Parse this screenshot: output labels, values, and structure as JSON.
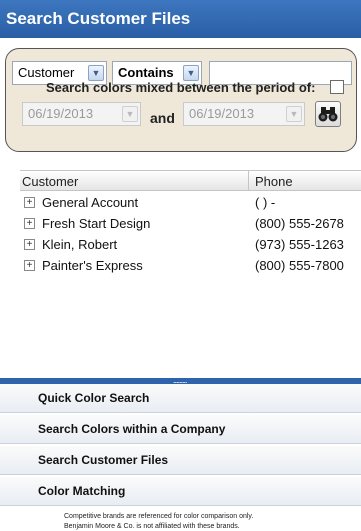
{
  "header": {
    "title": "Search Customer Files"
  },
  "search": {
    "field_select": "Customer",
    "operator_select": "Contains",
    "query_value": "",
    "period_label": "Search colors mixed between the period of:",
    "period_checked": false,
    "date_from": "06/19/2013",
    "and_label": "and",
    "date_to": "06/19/2013"
  },
  "table": {
    "columns": [
      "Customer",
      "Phone"
    ],
    "rows": [
      {
        "customer": "General Account",
        "phone": "(  )   -"
      },
      {
        "customer": "Fresh Start Design",
        "phone": "(800) 555-2678"
      },
      {
        "customer": "Klein, Robert",
        "phone": "(973) 555-1263"
      },
      {
        "customer": "Painter's Express",
        "phone": "(800) 555-7800"
      }
    ]
  },
  "nav": {
    "items": [
      "Quick Color Search",
      "Search Colors within a Company",
      "Search Customer Files",
      "Color Matching"
    ]
  },
  "footer": {
    "line1": "Competitive brands are referenced for color comparison only.",
    "line2": "Benjamin Moore & Co. is not affiliated with these brands."
  },
  "icons": {
    "dropdown": "chevron-down-icon",
    "search": "binoculars-icon",
    "expand": "plus-box-icon"
  },
  "colors": {
    "title_bar": "#2f64ad",
    "panel_bg": "#efe8d8"
  }
}
